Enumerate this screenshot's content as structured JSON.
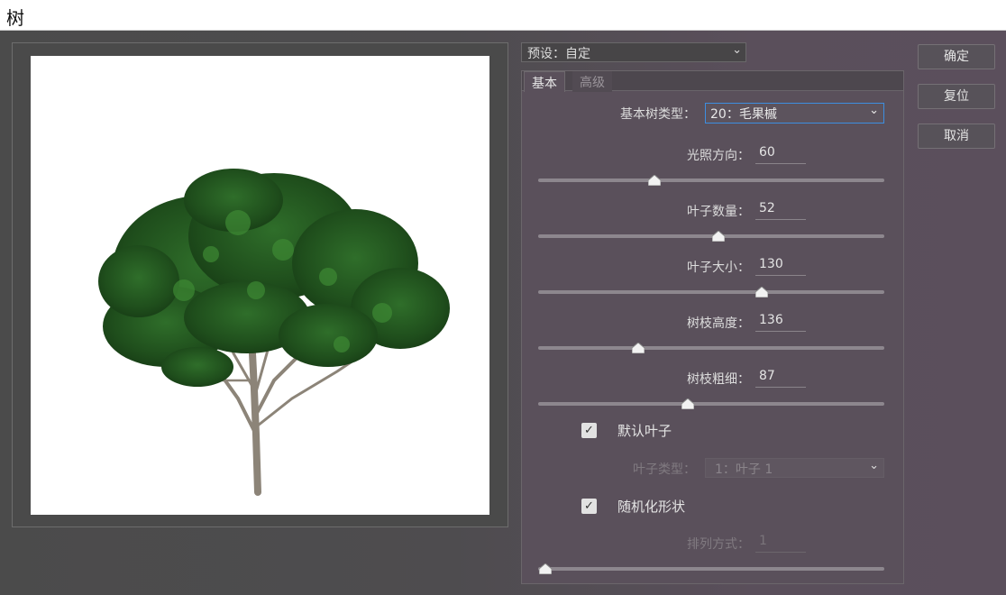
{
  "window": {
    "title": "树"
  },
  "preset": {
    "label": "预设：自定"
  },
  "buttons": {
    "ok": "确定",
    "reset": "复位",
    "cancel": "取消"
  },
  "tabs": [
    {
      "label": "基本",
      "active": true
    },
    {
      "label": "高级",
      "active": false
    }
  ],
  "tree_type": {
    "label": "基本树类型：",
    "value": "20：毛果槭"
  },
  "sliders": [
    {
      "label": "光照方向：",
      "value": "60",
      "fraction": 0.335
    },
    {
      "label": "叶子数量：",
      "value": "52",
      "fraction": 0.52
    },
    {
      "label": "叶子大小：",
      "value": "130",
      "fraction": 0.645
    },
    {
      "label": "树枝高度：",
      "value": "136",
      "fraction": 0.29
    },
    {
      "label": "树枝粗细：",
      "value": "87",
      "fraction": 0.433
    }
  ],
  "default_leaf": {
    "label": "默认叶子",
    "checked": true
  },
  "leaf_type": {
    "label": "叶子类型：",
    "value": "1：叶子 1"
  },
  "randomize": {
    "label": "随机化形状",
    "checked": true
  },
  "arrangement": {
    "label": "排列方式：",
    "value": "1",
    "fraction": 0.0
  },
  "icons": {
    "dropdown": "chevron-down-icon",
    "check": "check-icon",
    "thumb": "slider-thumb-icon"
  }
}
